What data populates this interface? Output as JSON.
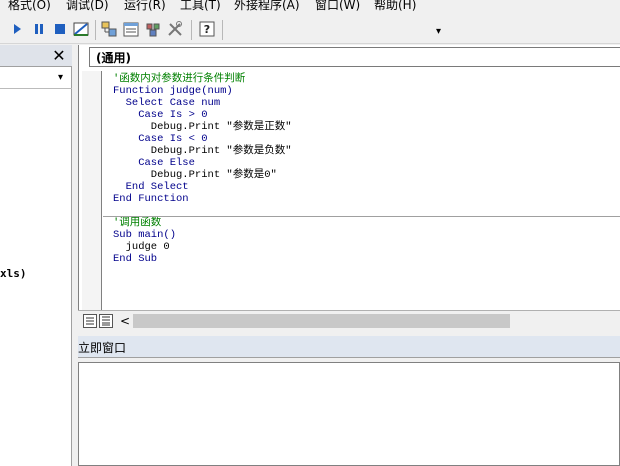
{
  "menu": [
    "格式(O)",
    "调试(D)",
    "运行(R)",
    "工具(T)",
    "外接程序(A)",
    "窗口(W)",
    "帮助(H)"
  ],
  "toolbar": {
    "icons": [
      "run-icon",
      "pause-icon",
      "stop-icon",
      "design-mode-icon",
      "project-explorer-icon",
      "properties-icon",
      "object-browser-icon",
      "toolbox-icon",
      "help-icon"
    ],
    "overflow": "▾"
  },
  "left_panel": {
    "close_glyph": "✕",
    "dropdown_glyph": "▾",
    "file_suffix": "xls)"
  },
  "code_window": {
    "procedure_combo": "(通用)",
    "lines": [
      {
        "text": "'函数内对参数进行条件判断",
        "kind": "cm"
      },
      {
        "text": "Function judge(num)",
        "kind": "kw"
      },
      {
        "text": "  Select Case num",
        "kind": "kw"
      },
      {
        "text": "    Case Is > 0",
        "kind": "kw"
      },
      {
        "text": "      Debug.Print \"参数是正数\"",
        "kind": "tx"
      },
      {
        "text": "    Case Is < 0",
        "kind": "kw"
      },
      {
        "text": "      Debug.Print \"参数是负数\"",
        "kind": "tx"
      },
      {
        "text": "    Case Else",
        "kind": "kw"
      },
      {
        "text": "      Debug.Print \"参数是0\"",
        "kind": "tx"
      },
      {
        "text": "  End Select",
        "kind": "kw"
      },
      {
        "text": "End Function",
        "kind": "kw"
      },
      {
        "text": "",
        "kind": "tx"
      },
      {
        "text": "'调用函数",
        "kind": "cm"
      },
      {
        "text": "Sub main()",
        "kind": "kw"
      },
      {
        "text": "  judge 0",
        "kind": "tx"
      },
      {
        "text": "End Sub",
        "kind": "kw"
      }
    ]
  },
  "scrollbar": {
    "left_arrow": "<"
  },
  "immediate": {
    "title": "立即窗口"
  }
}
